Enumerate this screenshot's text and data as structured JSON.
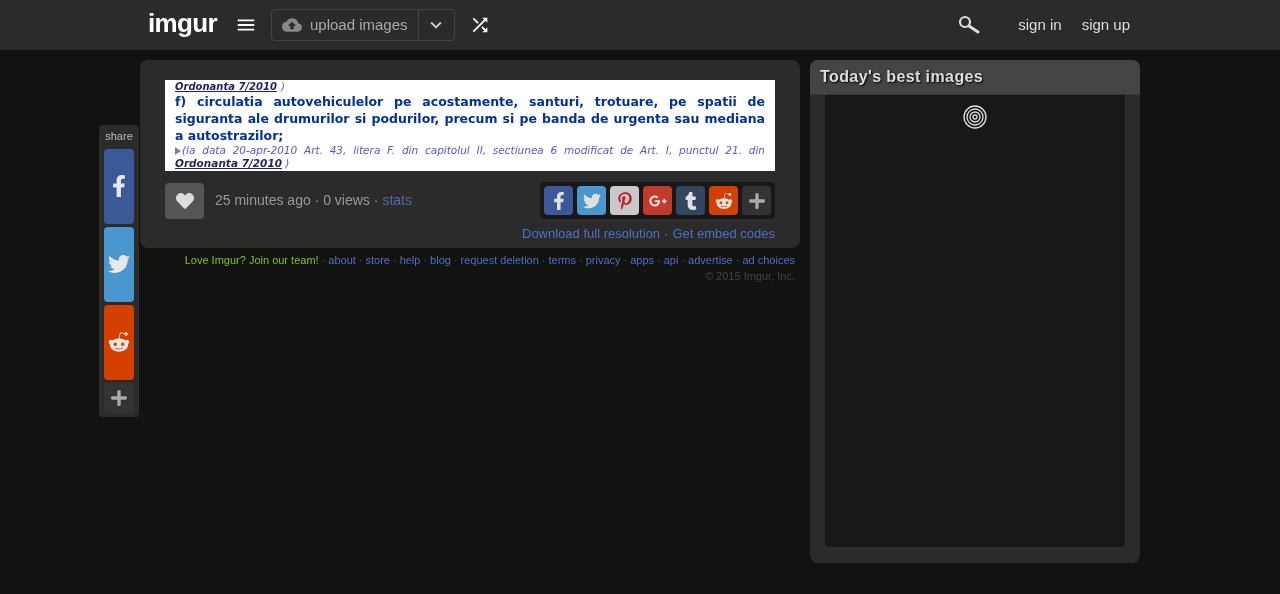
{
  "header": {
    "logo": "imgur",
    "upload_button": "upload images",
    "nav_links": [
      "sign in",
      "sign up"
    ]
  },
  "share_rail": {
    "label": "share",
    "buttons": [
      {
        "kind": "facebook"
      },
      {
        "kind": "twitter"
      },
      {
        "kind": "reddit"
      },
      {
        "kind": "more"
      }
    ]
  },
  "post": {
    "document": {
      "top_link": "Ordonanta 7/2010",
      "top_tail": ")",
      "paragraph": "f) circulatia autovehiculelor pe acostamente, santuri, trotuare, pe spatii de siguranta ale drumurilor si podurilor, precum si pe banda de urgenta sau mediana a autostrazilor;",
      "note": "(la data 20-apr-2010 Art. 43, litera F. din capitolul II, sectiunea 6 modificat de Art. I, punctul 21. din",
      "note_link": "Ordonanta 7/2010",
      "note_tail": ")"
    },
    "meta": "25 minutes ago · 0 views ·",
    "stats_link": "stats",
    "share_buttons": [
      {
        "kind": "facebook"
      },
      {
        "kind": "twitter"
      },
      {
        "kind": "pinterest"
      },
      {
        "kind": "googleplus"
      },
      {
        "kind": "tumblr"
      },
      {
        "kind": "reddit"
      },
      {
        "kind": "more"
      }
    ],
    "links": [
      "Download full resolution",
      "Get embed codes"
    ],
    "separator": "·"
  },
  "footer": {
    "join": "Love Imgur? Join our team!",
    "separator": "·",
    "links": [
      "about",
      "store",
      "help",
      "blog",
      "request deletion",
      "terms",
      "privacy",
      "apps",
      "api",
      "advertise",
      "ad choices"
    ],
    "copyright": "© 2015 Imgur, Inc."
  },
  "sidebar": {
    "title": "Today's best images"
  }
}
